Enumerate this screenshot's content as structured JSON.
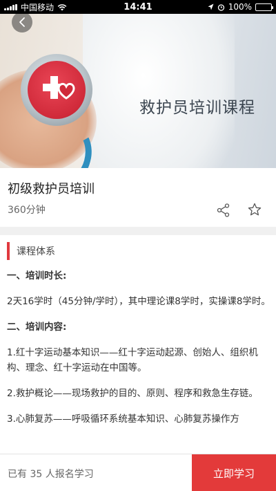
{
  "status_bar": {
    "carrier": "中国移动",
    "time": "14:41",
    "battery": "100%"
  },
  "banner": {
    "title": "救护员培训课程"
  },
  "course": {
    "title": "初级救护员培训",
    "duration": "360分钟"
  },
  "section": {
    "title": "课程体系"
  },
  "content": {
    "paragraphs": [
      "一、培训时长:",
      "2天16学时（45分钟/学时），其中理论课8学时，实操课8学时。",
      "二、培训内容:",
      "1.红十字运动基本知识——红十字运动起源、创始人、组织机构、理念、红十字运动在中国等。",
      "2.救护概论——现场救护的目的、原则、程序和救急生存链。",
      "3.心肺复苏——呼吸循环系统基本知识、心肺复苏操作方"
    ]
  },
  "footer": {
    "enroll_text": "已有 35 人报名学习",
    "study_button": "立即学习"
  },
  "colors": {
    "accent": "#e33a3a",
    "section_bar": "#e0393e"
  },
  "icons": {
    "back": "chevron-left-icon",
    "share": "share-icon",
    "favorite": "star-icon"
  }
}
